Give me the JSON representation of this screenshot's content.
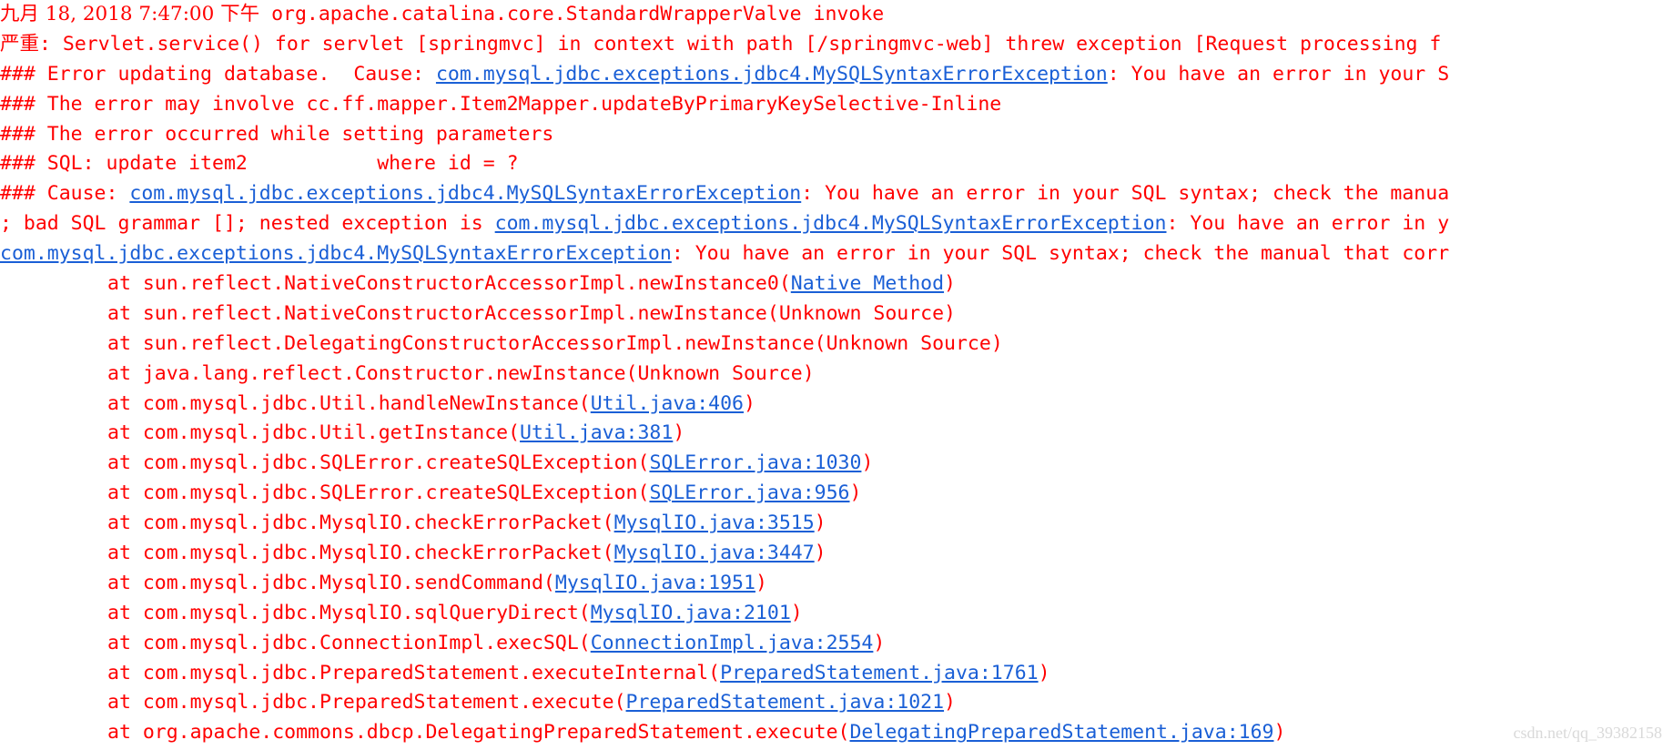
{
  "colors": {
    "text": "#ff0000",
    "link": "#1a5fd6",
    "background": "#ffffff",
    "watermark": "#d9d9d9"
  },
  "header": {
    "date": "九月 18, 2018 7:47:00 下午",
    "logger": " org.apache.catalina.core.StandardWrapperValve invoke",
    "severity": "严重",
    "message": ": Servlet.service() for servlet [springmvc] in context with path [/springmvc-web] threw exception [Request processing f"
  },
  "messages": {
    "error_updating_prefix": "### Error updating database.  Cause: ",
    "error_updating_link": "com.mysql.jdbc.exceptions.jdbc4.MySQLSyntaxErrorException",
    "error_updating_suffix": ": You have an error in your S",
    "may_involve": "### The error may involve cc.ff.mapper.Item2Mapper.updateByPrimaryKeySelective-Inline",
    "occurred_while": "### The error occurred while setting parameters",
    "sql": "### SQL: update item2           where id = ?",
    "cause_prefix": "### Cause: ",
    "cause_link": "com.mysql.jdbc.exceptions.jdbc4.MySQLSyntaxErrorException",
    "cause_suffix": ": You have an error in your SQL syntax; check the manua",
    "bad_sql_prefix": "; bad SQL grammar []; nested exception is ",
    "bad_sql_link": "com.mysql.jdbc.exceptions.jdbc4.MySQLSyntaxErrorException",
    "bad_sql_suffix": ": You have an error in y",
    "exception_link": "com.mysql.jdbc.exceptions.jdbc4.MySQLSyntaxErrorException",
    "exception_suffix": ": You have an error in your SQL syntax; check the manual that corr"
  },
  "stack_frames": [
    {
      "method": "at sun.reflect.NativeConstructorAccessorImpl.newInstance0(",
      "source": "Native Method",
      "is_link": true
    },
    {
      "method": "at sun.reflect.NativeConstructorAccessorImpl.newInstance(",
      "source": "Unknown Source",
      "is_link": false
    },
    {
      "method": "at sun.reflect.DelegatingConstructorAccessorImpl.newInstance(",
      "source": "Unknown Source",
      "is_link": false
    },
    {
      "method": "at java.lang.reflect.Constructor.newInstance(",
      "source": "Unknown Source",
      "is_link": false
    },
    {
      "method": "at com.mysql.jdbc.Util.handleNewInstance(",
      "source": "Util.java:406",
      "is_link": true
    },
    {
      "method": "at com.mysql.jdbc.Util.getInstance(",
      "source": "Util.java:381",
      "is_link": true
    },
    {
      "method": "at com.mysql.jdbc.SQLError.createSQLException(",
      "source": "SQLError.java:1030",
      "is_link": true
    },
    {
      "method": "at com.mysql.jdbc.SQLError.createSQLException(",
      "source": "SQLError.java:956",
      "is_link": true
    },
    {
      "method": "at com.mysql.jdbc.MysqlIO.checkErrorPacket(",
      "source": "MysqlIO.java:3515",
      "is_link": true
    },
    {
      "method": "at com.mysql.jdbc.MysqlIO.checkErrorPacket(",
      "source": "MysqlIO.java:3447",
      "is_link": true
    },
    {
      "method": "at com.mysql.jdbc.MysqlIO.sendCommand(",
      "source": "MysqlIO.java:1951",
      "is_link": true
    },
    {
      "method": "at com.mysql.jdbc.MysqlIO.sqlQueryDirect(",
      "source": "MysqlIO.java:2101",
      "is_link": true
    },
    {
      "method": "at com.mysql.jdbc.ConnectionImpl.execSQL(",
      "source": "ConnectionImpl.java:2554",
      "is_link": true
    },
    {
      "method": "at com.mysql.jdbc.PreparedStatement.executeInternal(",
      "source": "PreparedStatement.java:1761",
      "is_link": true
    },
    {
      "method": "at com.mysql.jdbc.PreparedStatement.execute(",
      "source": "PreparedStatement.java:1021",
      "is_link": true
    },
    {
      "method": "at org.apache.commons.dbcp.DelegatingPreparedStatement.execute(",
      "source": "DelegatingPreparedStatement.java:169",
      "is_link": true
    }
  ],
  "watermark": "csdn.net/qq_39382158"
}
